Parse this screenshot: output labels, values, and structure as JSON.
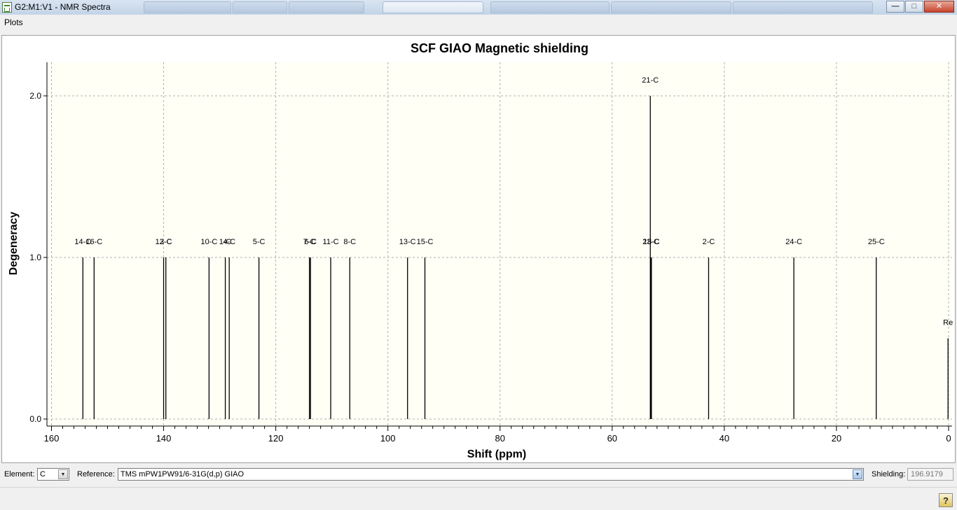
{
  "window": {
    "title": "G2:M1:V1 - NMR Spectra",
    "buttons": {
      "minimize": "—",
      "maximize": "□",
      "close": "✕"
    }
  },
  "menu": {
    "items": [
      "Plots"
    ]
  },
  "chart_data": {
    "type": "bar",
    "title": "SCF GIAO Magnetic shielding",
    "xlabel": "Shift (ppm)",
    "ylabel": "Degeneracy",
    "xlim": [
      160,
      0
    ],
    "ylim": [
      0,
      2.2
    ],
    "x_ticks": [
      160,
      140,
      120,
      100,
      80,
      60,
      40,
      20,
      0
    ],
    "x_tick_labels": [
      "160",
      "140",
      "120",
      "100",
      "80",
      "60",
      "40",
      "20",
      "0"
    ],
    "y_ticks": [
      0.0,
      1.0,
      2.0
    ],
    "y_tick_labels": [
      "0.0",
      "1.0",
      "2.0"
    ],
    "grid": true,
    "peaks": [
      {
        "label": "14-C",
        "shift": 154.4,
        "degeneracy": 1
      },
      {
        "label": "16-C",
        "shift": 152.4,
        "degeneracy": 1
      },
      {
        "label": "12-C",
        "shift": 140.0,
        "degeneracy": 1
      },
      {
        "label": "3-C",
        "shift": 139.6,
        "degeneracy": 1
      },
      {
        "label": "10-C",
        "shift": 131.9,
        "degeneracy": 1
      },
      {
        "label": "1-C",
        "shift": 129.0,
        "degeneracy": 1
      },
      {
        "label": "4-C",
        "shift": 128.3,
        "degeneracy": 1
      },
      {
        "label": "5-C",
        "shift": 123.0,
        "degeneracy": 1
      },
      {
        "label": "7-C",
        "shift": 114.0,
        "degeneracy": 1
      },
      {
        "label": "6-C",
        "shift": 113.8,
        "degeneracy": 1
      },
      {
        "label": "11-C",
        "shift": 110.2,
        "degeneracy": 1
      },
      {
        "label": "8-C",
        "shift": 106.8,
        "degeneracy": 1
      },
      {
        "label": "13-C",
        "shift": 96.5,
        "degeneracy": 1
      },
      {
        "label": "15-C",
        "shift": 93.4,
        "degeneracy": 1
      },
      {
        "label": "21-C",
        "shift": 53.2,
        "degeneracy": 2
      },
      {
        "label": "23-C",
        "shift": 53.1,
        "degeneracy": 1
      },
      {
        "label": "18-C",
        "shift": 53.0,
        "degeneracy": 1
      },
      {
        "label": "2-C",
        "shift": 42.8,
        "degeneracy": 1
      },
      {
        "label": "24-C",
        "shift": 27.6,
        "degeneracy": 1
      },
      {
        "label": "25-C",
        "shift": 12.9,
        "degeneracy": 1
      },
      {
        "label": "Re",
        "shift": 0.1,
        "degeneracy": 0.5
      }
    ],
    "colors": {
      "plot_bg": "#fffff6",
      "line": "#000000",
      "grid": "#b0b0b0"
    }
  },
  "controls": {
    "element_label": "Element:",
    "element_value": "C",
    "reference_label": "Reference:",
    "reference_value": "TMS mPW1PW91/6-31G(d,p) GIAO",
    "shielding_label": "Shielding:",
    "shielding_value": "196.9179",
    "dropdown_glyph": "▼"
  },
  "status": {
    "help_glyph": "?"
  }
}
